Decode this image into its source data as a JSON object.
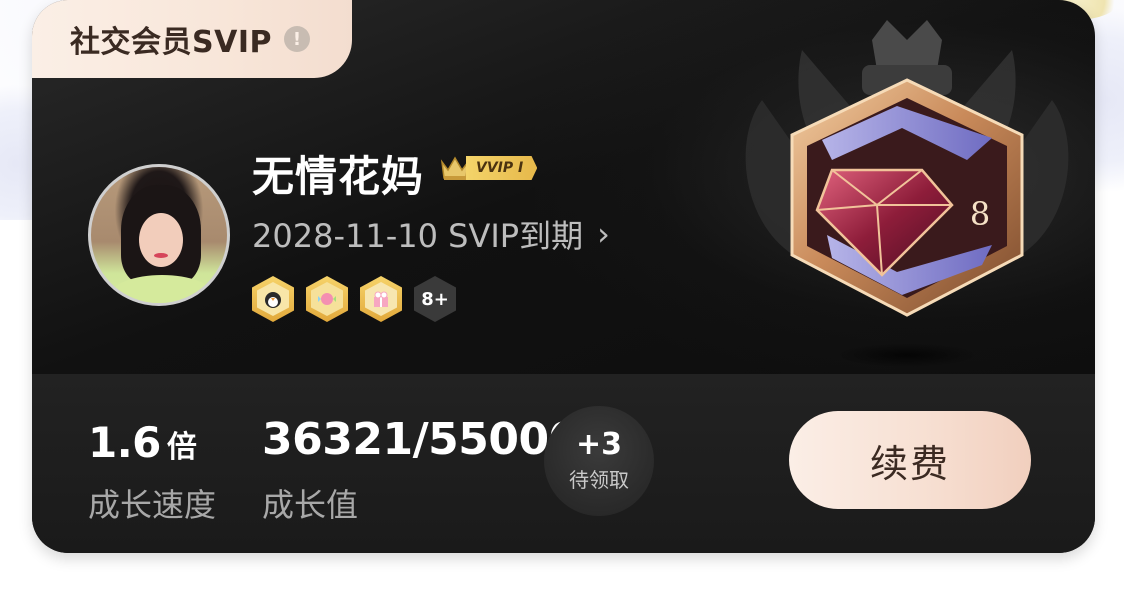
{
  "header": {
    "tab_title": "社交会员SVIP",
    "info_icon": "info-icon"
  },
  "profile": {
    "avatar_icon": "user-avatar",
    "username": "无情花妈",
    "vip_tag": "VVIP I",
    "expiry_text": "2028-11-10 SVIP到期",
    "expiry_chevron": "›",
    "medals": [
      {
        "icon": "penguin-medal-icon",
        "glyph": "🐧"
      },
      {
        "icon": "candy-medal-icon",
        "glyph": "🍬"
      },
      {
        "icon": "gift-medal-icon",
        "glyph": "🎁"
      }
    ],
    "more_medals": "8+"
  },
  "level_emblem": {
    "level": "8",
    "icon": "diamond-level-emblem"
  },
  "stats": {
    "speed_value": "1.6",
    "speed_unit": "倍",
    "speed_label": "成长速度",
    "growth_value": "36321/55000",
    "growth_label": "成长值",
    "growth_current": 36321,
    "growth_target": 55000
  },
  "pending": {
    "count": "+3",
    "label": "待领取"
  },
  "renew_button": {
    "label": "续费"
  },
  "colors": {
    "card_bg": "#111111",
    "tab_bg": "#f8e6d9",
    "button_bg": "#f7e0d3",
    "gold": "#e6b84a"
  }
}
